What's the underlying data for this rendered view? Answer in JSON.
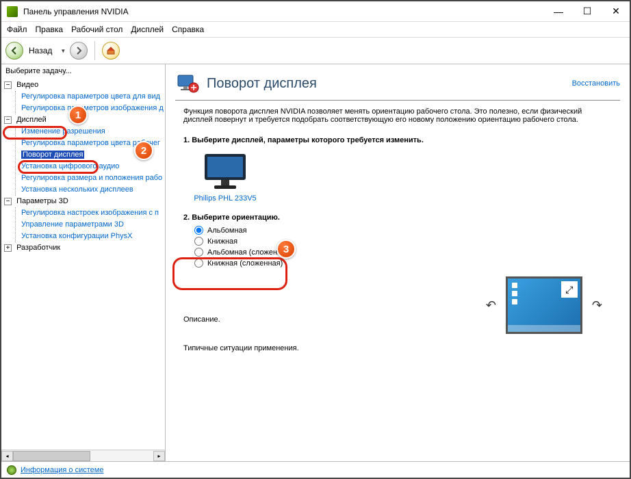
{
  "window": {
    "title": "Панель управления NVIDIA"
  },
  "menu": {
    "file": "Файл",
    "edit": "Правка",
    "desktop": "Рабочий стол",
    "display": "Дисплей",
    "help": "Справка"
  },
  "toolbar": {
    "back_label": "Назад"
  },
  "sidebar": {
    "header": "Выберите задачу...",
    "video": {
      "label": "Видео",
      "items": [
        "Регулировка параметров цвета для вид",
        "Регулировка параметров изображения д"
      ]
    },
    "display": {
      "label": "Дисплей",
      "items": [
        "Изменение разрешения",
        "Регулировка параметров цвета рабочег",
        "Поворот дисплея",
        "Установка цифрового аудио",
        "Регулировка размера и положения рабо",
        "Установка нескольких дисплеев"
      ]
    },
    "params3d": {
      "label": "Параметры 3D",
      "items": [
        "Регулировка настроек изображения с п",
        "Управление параметрами 3D",
        "Установка конфигурации PhysX"
      ]
    },
    "developer": {
      "label": "Разработчик"
    }
  },
  "content": {
    "title": "Поворот дисплея",
    "restore": "Восстановить",
    "description": "Функция поворота дисплея NVIDIA позволяет менять ориентацию рабочего стола. Это полезно, если физический дисплей повернут и требуется подобрать соответствующую его новому положению ориентацию рабочего стола.",
    "step1": "1. Выберите дисплей, параметры которого требуется изменить.",
    "monitor_label": "Philips PHL 233V5",
    "step2": "2. Выберите ориентацию.",
    "orientations": [
      "Альбомная",
      "Книжная",
      "Альбомная (сложенная)",
      "Книжная (сложенная)"
    ],
    "desc_heading": "Описание.",
    "typical_heading": "Типичные ситуации применения."
  },
  "footer": {
    "sysinfo": "Информация о системе"
  },
  "badges": {
    "b1": "1",
    "b2": "2",
    "b3": "3"
  }
}
